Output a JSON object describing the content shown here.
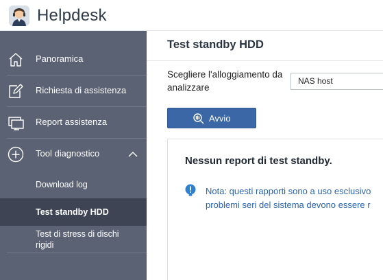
{
  "header": {
    "app_title": "Helpdesk",
    "app_icon": "helpdesk-agent-icon"
  },
  "sidebar": {
    "items": [
      {
        "label": "Panoramica",
        "icon": "home-icon"
      },
      {
        "label": "Richiesta di assistenza",
        "icon": "edit-icon"
      },
      {
        "label": "Report assistenza",
        "icon": "monitor-icon"
      },
      {
        "label": "Tool diagnostico",
        "icon": "plus-circle-icon",
        "expanded": true
      }
    ],
    "sub_items": [
      {
        "label": "Download log",
        "active": false
      },
      {
        "label": "Test standby HDD",
        "active": true
      },
      {
        "label": "Test di stress di dischi rigidi",
        "active": false
      }
    ]
  },
  "main": {
    "title": "Test standby HDD",
    "enclosure_label": "Scegliere l'alloggiamento da analizzare",
    "enclosure_value": "NAS host",
    "start_label": "Avvio",
    "panel": {
      "title": "Nessun report di test standby.",
      "note_line1": "Nota: questi rapporti sono a uso esclusivo",
      "note_line2": "problemi seri del sistema devono essere r"
    }
  },
  "colors": {
    "sidebar_bg": "#5b6273",
    "sidebar_active": "#3e4454",
    "primary_button": "#3b67a6",
    "note_text": "#2b64ad",
    "info_icon": "#2f80d1"
  }
}
